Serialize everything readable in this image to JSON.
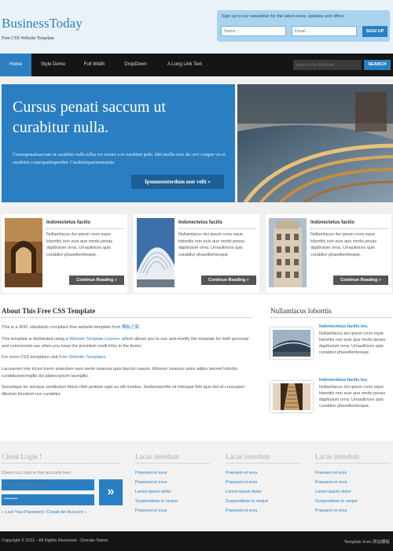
{
  "header": {
    "logo": "BusinessToday",
    "tagline": "Free CSS Website Template",
    "newsletter": {
      "label": "Sign up to our newsletter for the latest news, updates and offers.",
      "name_placeholder": "Name ...",
      "email_placeholder": "Email ...",
      "button": "SIGN UP"
    }
  },
  "nav": {
    "items": [
      "Home",
      "Style Demo",
      "Full Width",
      "DropDown",
      "A Long Link Text"
    ],
    "search_placeholder": "Search Our Website...",
    "search_button": "SEARCH"
  },
  "hero": {
    "title": "Cursus penati saccum ut curabitur nulla.",
    "text": "Cursuspenatisaccum ut curabitur nulla tellus tor ornare a in curabitur pede. Idet mollis eros dis orci congue vis et curabitur consequatimperdiet. Curabiturpariaturentate.",
    "button": "Ipsumsenterdum non velit »"
  },
  "cards": [
    {
      "title": "Indonectetus facilis",
      "text": "Nullamlacus dui ipsum cons eque loborttis non euis que morbi penas dapibulum orna. Urnaultrices quis curabitur phasellentesque.",
      "button": "Continue Reading »"
    },
    {
      "title": "Indonectetus facilis",
      "text": "Nullamlacus dui ipsum cons eque loborttis non euis que morbi penas dapibulum orna. Urnaultrices quis curabitur phasellentesque.",
      "button": "Continue Reading »"
    },
    {
      "title": "Indonectetus facilis",
      "text": "Nullamlacus dui ipsum cons eque loborttis non euis que morbi penas dapibulum orna. Urnaultrices quis curabitur phasellentesque.",
      "button": "Continue Reading »"
    }
  ],
  "about": {
    "title": "About This Free CSS Template",
    "p1_pre": "This is a W3C standards compliant free website template from ",
    "p1_link": "模板之家",
    "p1_post": ".",
    "p2_pre": "This template is distributed using a ",
    "p2_link": "Website Template Licence",
    "p2_post": ", which allows you to use and modify the template for both personal and commercial use when you keep the provided credit links in the footer.",
    "p3_pre": "For more CSS templates visit ",
    "p3_link": "Free Website Templates",
    "p3_post": ".",
    "p4": "Lacusenim inte trices lorem anterdum nam sente vivamus quis fauctor mauris. Wisinon vivamus wisis adipis laoreet lobortis curabiturpiscingilla dui platea ipsum lacingilla.",
    "p5": "Semalique tor sempus vestibulum libero nibh pretium eget eu elit montes. Sedsemporttis sit intesque felit quis elis et cursuspen dibulum tincidunt non curabitur."
  },
  "sidebar": {
    "title": "Nullamlacus loborttis",
    "items": [
      {
        "head": "Indonectetus facilis leo.",
        "text": "Nullamlacus dui ipsum cons eque loborttis non euis que morbi penas dapibulum orna. Urnaultrices quis curabitur phasellentesque."
      },
      {
        "head": "Indonectetus facilis leo.",
        "text": "Nullamlacus dui ipsum cons eque loborttis non euis que morbi penas dapibulum orna. Urnaultrices quis curabitur phasellentesque."
      }
    ]
  },
  "footer": {
    "login": {
      "title": "Client Login !",
      "subtitle": "Clients can Login to their accounts here.",
      "email_placeholder": "Enter email address...",
      "password_value": "•••••••••",
      "links": "» Lost Your Password / Create An Account »"
    },
    "columns": [
      {
        "title": "Lacus interdum",
        "links": [
          "Praesent et eros",
          "Praesent et eros",
          "Lorem ipsum dolor",
          "Suspendisse in neque",
          "Praesent et eros"
        ]
      },
      {
        "title": "Lacus interdum",
        "links": [
          "Praesent et eros",
          "Praesent et eros",
          "Lorem ipsum dolor",
          "Suspendisse in neque",
          "Praesent et eros"
        ]
      },
      {
        "title": "Lacus interdum",
        "links": [
          "Praesent et eros",
          "Praesent et eros",
          "Lorem ipsum dolor",
          "Suspendisse in neque",
          "Praesent et eros"
        ]
      }
    ],
    "copyright": "Copyright © 2011 - All Rights Reserved - Domain Name",
    "credit": "Template from 网站模板"
  },
  "colors": {
    "accent": "#2a7fc2",
    "dark": "#151515",
    "light": "#f0f0f0"
  }
}
